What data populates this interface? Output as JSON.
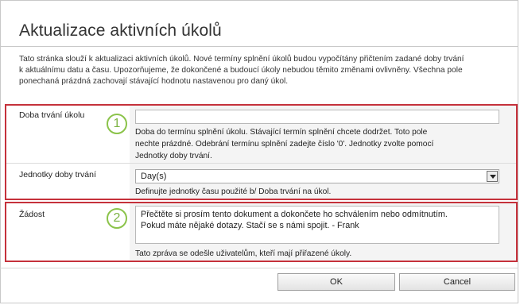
{
  "dialog": {
    "title": "Aktualizace aktivních úkolů",
    "intro": "Tato stránka slouží k aktualizaci aktivních úkolů. Nové termíny splnění úkolů budou vypočítány přičtením zadané doby trvání k aktuálnímu datu a času. Upozorňujeme, že dokončené a budoucí úkoly nebudou těmito změnami ovlivněny. Všechna pole ponechaná prázdná zachovají stávající hodnotu nastavenou pro daný úkol."
  },
  "section1": {
    "badge": "1",
    "duration": {
      "label": "Doba trvání úkolu",
      "value": "",
      "description_line1": "Doba do termínu splnění úkolu. Stávající termín splnění chcete dodržet. Toto pole",
      "description_line2": "nechte prázdné. Odebrání termínu splnění zadejte číslo '0'. Jednotky zvolte pomocí",
      "description_line3": "Jednotky doby trvání."
    },
    "units": {
      "label": "Jednotky doby trvání",
      "selected": "Day(s)",
      "description": "Definujte jednotky času použité b/ Doba trvání na úkol."
    }
  },
  "section2": {
    "badge": "2",
    "request": {
      "label": "Žádost",
      "value": "Přečtěte si prosím tento dokument a dokončete ho schválením nebo odmítnutím.\nPokud máte nějaké dotazy. Stačí se s námi spojit. - Frank",
      "description": "Tato zpráva se odešle uživatelům, kteří mají přiřazené úkoly."
    }
  },
  "buttons": {
    "ok": "OK",
    "cancel": "Cancel"
  }
}
